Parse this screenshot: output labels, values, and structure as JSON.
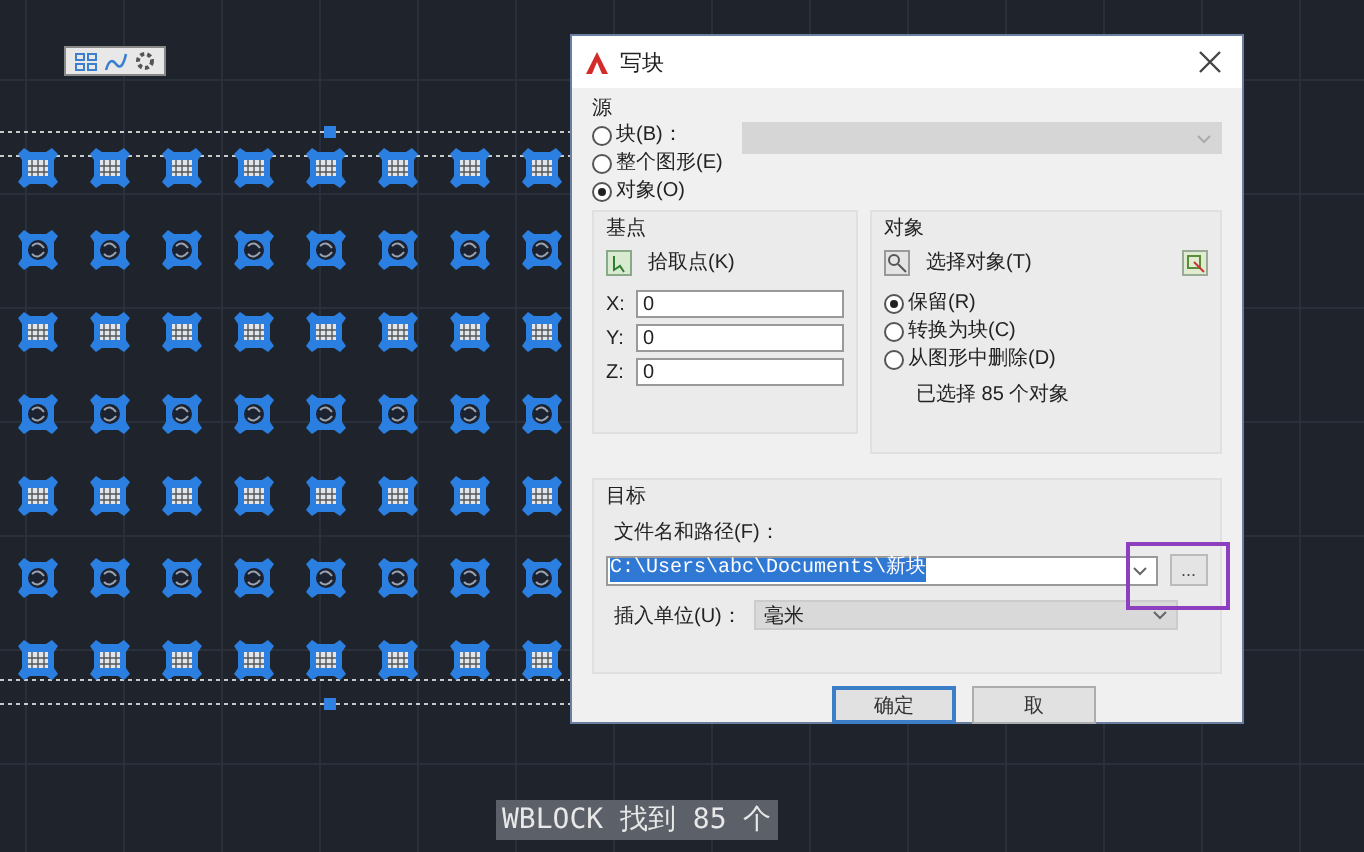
{
  "dialog": {
    "title": "写块",
    "source": {
      "heading": "源",
      "block_list": {
        "disabled": true
      },
      "options": [
        {
          "label": "块(B)：",
          "selected": false
        },
        {
          "label": "整个图形(E)",
          "selected": false
        },
        {
          "label": "对象(O)",
          "selected": true
        }
      ]
    },
    "base_point": {
      "heading": "基点",
      "pick_label": "拾取点(K)",
      "coords": [
        {
          "axis": "X:",
          "value": "0"
        },
        {
          "axis": "Y:",
          "value": "0"
        },
        {
          "axis": "Z:",
          "value": "0"
        }
      ]
    },
    "objects": {
      "heading": "对象",
      "select_label": "选择对象(T)",
      "options": [
        {
          "label": "保留(R)",
          "selected": true
        },
        {
          "label": "转换为块(C)",
          "selected": false
        },
        {
          "label": "从图形中删除(D)",
          "selected": false
        }
      ],
      "count_text": "已选择 85 个对象"
    },
    "destination": {
      "heading": "目标",
      "file_label": "文件名和路径(F)：",
      "file_value": "C:\\Users\\abc\\Documents\\新块",
      "browse_label": "...",
      "units_label": "插入单位(U)：",
      "units_value": "毫米"
    },
    "buttons": [
      {
        "label": "确定",
        "selected": true
      },
      {
        "label": "取",
        "selected": false
      }
    ]
  },
  "command_line": "WBLOCK 找到 85 个"
}
